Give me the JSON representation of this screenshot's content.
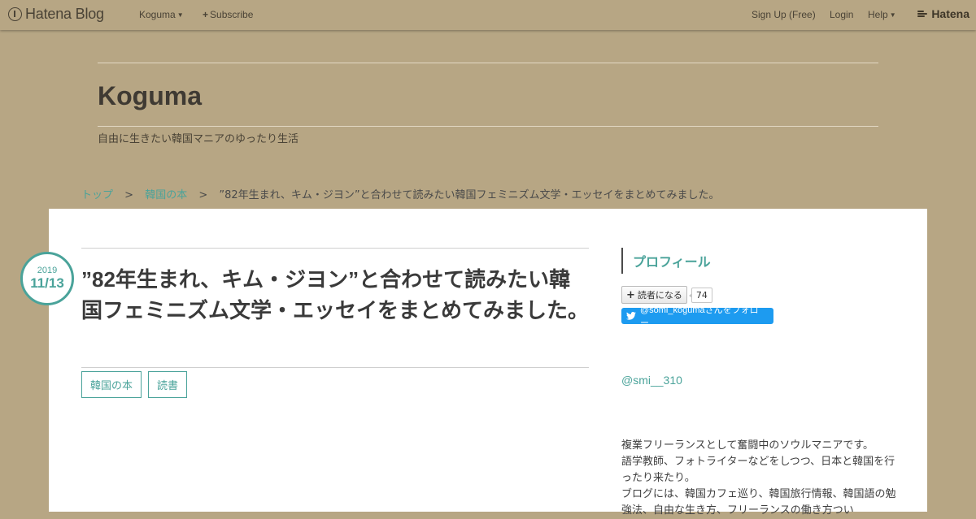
{
  "globalbar": {
    "logo_text": "Hatena Blog",
    "blog_menu": "Koguma",
    "subscribe": "Subscribe",
    "signup": "Sign Up (Free)",
    "login": "Login",
    "help": "Help",
    "brand": "Hatena"
  },
  "header": {
    "title": "Koguma",
    "description": "自由に生きたい韓国マニアのゆったり生活"
  },
  "breadcrumb": {
    "items": [
      "トップ",
      "韓国の本"
    ],
    "separator": ">",
    "current": "”82年生まれ、キム・ジヨン”と合わせて読みたい韓国フェミニズム文学・エッセイをまとめてみました。"
  },
  "entry": {
    "date_year": "2019",
    "date_md": "11/13",
    "title": "”82年生まれ、キム・ジヨン”と合わせて読みたい韓国フェミニズム文学・エッセイをまとめてみました。",
    "tags": [
      "韓国の本",
      "読書"
    ]
  },
  "sidebar": {
    "profile_heading": "プロフィール",
    "subscribe_label": "読者になる",
    "subscriber_count": "74",
    "twitter_follow": "@somi_kogumaさんをフォロー",
    "handle": "@smi__310",
    "bio_lines": [
      "複業フリーランスとして奮闘中のソウルマニアです。",
      "語学教師、フォトライターなどをしつつ、日本と韓国を行ったり来たり。",
      "ブログには、韓国カフェ巡り、韓国旅行情報、韓国語の勉強法、自由な生き方、フリーランスの働き方つい"
    ]
  },
  "colors": {
    "background": "#b7a684",
    "accent": "#4aa39a",
    "twitter": "#1d9bf0"
  }
}
